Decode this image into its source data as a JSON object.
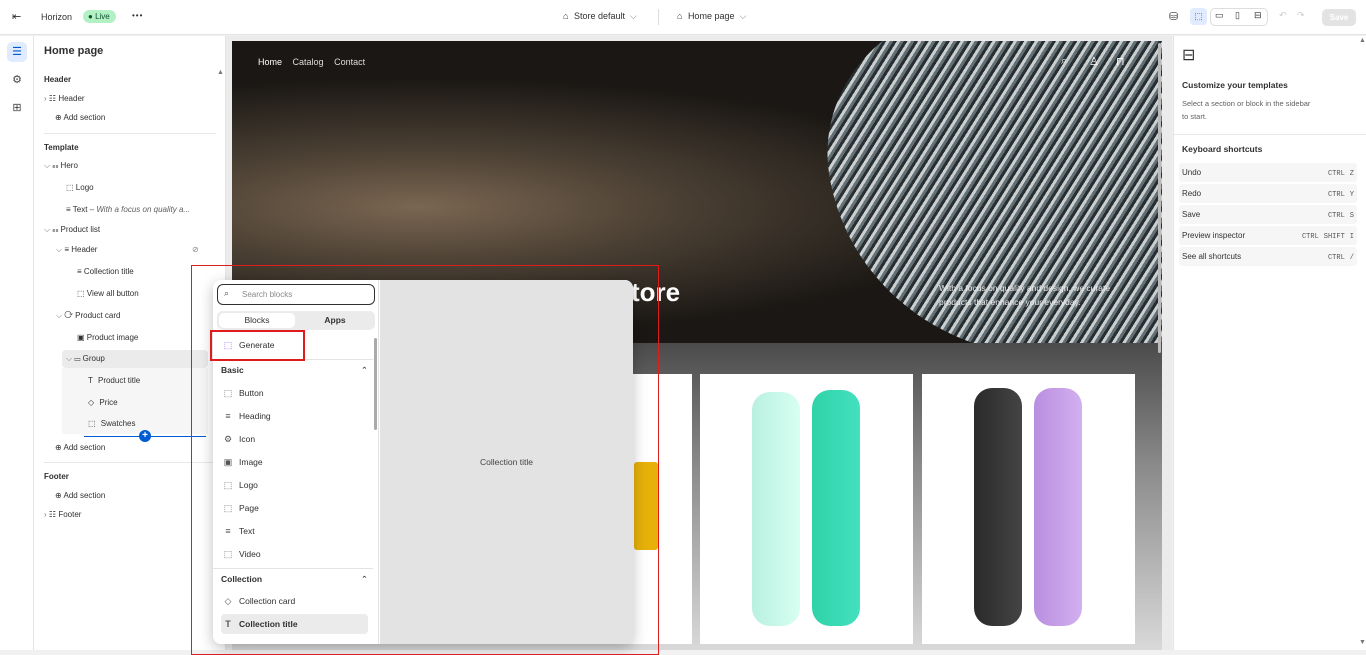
{
  "topbar": {
    "store_name": "Horizon",
    "live_badge": "Live",
    "more": "•••",
    "store_selector": "Store default",
    "page_selector": "Home page",
    "save_label": "Save"
  },
  "sidebar": {
    "title": "Home page",
    "header_section": "Header",
    "header_item": "Header",
    "add_section": "Add section",
    "template_section": "Template",
    "hero": "Hero",
    "logo": "Logo",
    "text_item": "Text",
    "text_item_detail": "– With a focus on quality a...",
    "product_list": "Product list",
    "pl_header": "Header",
    "collection_title": "Collection title",
    "view_all_button": "View all button",
    "product_card": "Product card",
    "product_image": "Product image",
    "group": "Group",
    "product_title": "Product title",
    "price": "Price",
    "swatches": "Swatches",
    "footer_section": "Footer",
    "footer_item": "Footer"
  },
  "preview": {
    "nav": [
      "Home",
      "Catalog",
      "Contact"
    ],
    "hero_title_fragment": "tore",
    "hero_text_line1": "With a focus on quality and design, we curate",
    "hero_text_line2": "products that enhance your everyday."
  },
  "popup": {
    "search_placeholder": "Search blocks",
    "tab_blocks": "Blocks",
    "tab_apps": "Apps",
    "generate": "Generate",
    "basic_group": "Basic",
    "basic_items": [
      "Button",
      "Heading",
      "Icon",
      "Image",
      "Logo",
      "Page",
      "Text",
      "Video"
    ],
    "collection_group": "Collection",
    "collection_items": [
      "Collection card",
      "Collection title"
    ],
    "preview_label": "Collection title"
  },
  "inspector": {
    "title": "Customize your templates",
    "subtitle_line1": "Select a section or block in the sidebar",
    "subtitle_line2": "to start.",
    "shortcuts_title": "Keyboard shortcuts",
    "shortcuts": [
      {
        "label": "Undo",
        "keys": [
          "CTRL",
          "Z"
        ]
      },
      {
        "label": "Redo",
        "keys": [
          "CTRL",
          "Y"
        ]
      },
      {
        "label": "Save",
        "keys": [
          "CTRL",
          "S"
        ]
      },
      {
        "label": "Preview inspector",
        "keys": [
          "CTRL",
          "SHIFT",
          "I"
        ]
      },
      {
        "label": "See all shortcuts",
        "keys": [
          "CTRL",
          "/"
        ]
      }
    ]
  },
  "colors": {
    "accent": "#005bd3",
    "live_green": "#b3f0c3",
    "highlight_red": "#e01b1b"
  }
}
